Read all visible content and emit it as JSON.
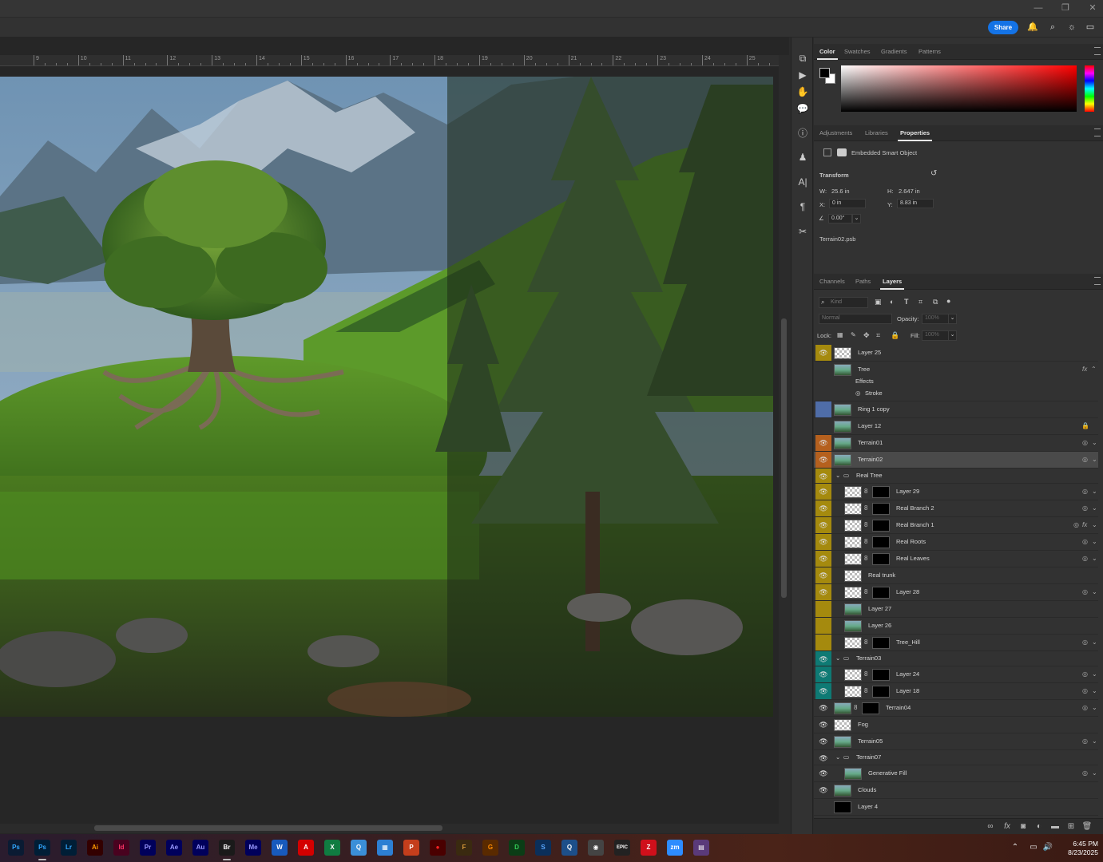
{
  "window": {
    "minimize": "—",
    "restore": "❐",
    "close": "✕"
  },
  "topbar": {
    "share_label": "Share",
    "icons": [
      "bell-icon",
      "search-icon",
      "lightbulb-icon",
      "workspace-icon"
    ]
  },
  "ruler": {
    "labels": [
      "9",
      "10",
      "11",
      "12",
      "13",
      "14",
      "15",
      "16",
      "17",
      "18",
      "19",
      "20",
      "21",
      "22",
      "23",
      "24",
      "25"
    ]
  },
  "color_panel": {
    "tabs": [
      "Color",
      "Swatches",
      "Gradients",
      "Patterns"
    ],
    "active_tab": "Color",
    "foreground": "#000000",
    "background": "#ffffff"
  },
  "properties_panel": {
    "tabs": [
      "Adjustments",
      "Libraries",
      "Properties"
    ],
    "active_tab": "Properties",
    "object_type": "Embedded Smart Object",
    "section_title": "Transform",
    "w_label": "W:",
    "w_value": "25.6 in",
    "h_label": "H:",
    "h_value": "2.647 in",
    "x_label": "X:",
    "x_value": "0 in",
    "y_label": "Y:",
    "y_value": "8.83 in",
    "angle_value": "0.00°",
    "file_name": "Terrain02.psb"
  },
  "layers_panel": {
    "tabs": [
      "Channels",
      "Paths",
      "Layers"
    ],
    "active_tab": "Layers",
    "filter_placeholder": "Kind",
    "blend_mode": "Normal",
    "opacity_label": "Opacity:",
    "opacity_value": "100%",
    "lock_label": "Lock:",
    "fill_label": "Fill:",
    "fill_value": "100%",
    "layers": [
      {
        "name": "Layer 25",
        "color": "#a58a0e",
        "eye": true,
        "thumb": "checker",
        "indent": 0
      },
      {
        "name": "Tree",
        "color": "",
        "eye": false,
        "thumb": "scene",
        "indent": 0,
        "fx": "fx",
        "effects": "Effects",
        "stroke": "Stroke"
      },
      {
        "name": "Ring 1 copy",
        "color": "#4f6da8",
        "eye": false,
        "thumb": "scene",
        "indent": 0
      },
      {
        "name": "Layer 12",
        "color": "",
        "eye": false,
        "thumb": "scene",
        "indent": 0,
        "locked": true
      },
      {
        "name": "Terrain01",
        "color": "#b5601e",
        "eye": true,
        "thumb": "scene",
        "indent": 0
      },
      {
        "name": "Terrain02",
        "color": "#b5601e",
        "eye": true,
        "thumb": "scene",
        "indent": 0,
        "selected": true
      },
      {
        "name": "Real Tree",
        "color": "#a58a0e",
        "eye": true,
        "group": true,
        "indent": 0
      },
      {
        "name": "Layer 29",
        "color": "#a58a0e",
        "eye": true,
        "thumb": "checker",
        "mask": true,
        "indent": 1
      },
      {
        "name": "Real Branch 2",
        "color": "#a58a0e",
        "eye": true,
        "thumb": "checker",
        "mask": true,
        "indent": 1
      },
      {
        "name": "Real Branch 1",
        "color": "#a58a0e",
        "eye": true,
        "thumb": "checker",
        "mask": true,
        "indent": 1,
        "fx": "fx"
      },
      {
        "name": "Real Roots",
        "color": "#a58a0e",
        "eye": true,
        "thumb": "checker",
        "mask": true,
        "indent": 1
      },
      {
        "name": "Real Leaves",
        "color": "#a58a0e",
        "eye": true,
        "thumb": "checker",
        "mask": true,
        "indent": 1
      },
      {
        "name": "Real trunk",
        "color": "#a58a0e",
        "eye": true,
        "thumb": "checker",
        "indent": 1
      },
      {
        "name": "Layer 28",
        "color": "#a58a0e",
        "eye": true,
        "thumb": "checker",
        "mask": true,
        "indent": 1
      },
      {
        "name": "Layer 27",
        "color": "#a58a0e",
        "eye": false,
        "thumb": "scene",
        "indent": 1
      },
      {
        "name": "Layer 26",
        "color": "#a58a0e",
        "eye": false,
        "thumb": "scene",
        "indent": 1
      },
      {
        "name": "Tree_Hill",
        "color": "#a58a0e",
        "eye": false,
        "thumb": "checker",
        "mask": true,
        "indent": 1
      },
      {
        "name": "Terrain03",
        "color": "#0e7a74",
        "eye": true,
        "group": true,
        "indent": 0
      },
      {
        "name": "Layer 24",
        "color": "#0e7a74",
        "eye": true,
        "thumb": "checker",
        "mask": true,
        "indent": 1
      },
      {
        "name": "Layer 18",
        "color": "#0e7a74",
        "eye": true,
        "thumb": "checker",
        "mask": true,
        "indent": 1
      },
      {
        "name": "Terrain04",
        "color": "",
        "eye": true,
        "thumb": "scene",
        "mask": true,
        "indent": 0
      },
      {
        "name": "Fog",
        "color": "",
        "eye": true,
        "thumb": "checker",
        "indent": 0
      },
      {
        "name": "Terrain05",
        "color": "",
        "eye": true,
        "thumb": "scene",
        "indent": 0
      },
      {
        "name": "Terrain07",
        "color": "",
        "eye": true,
        "group": true,
        "indent": 0
      },
      {
        "name": "Generative Fill",
        "color": "",
        "eye": true,
        "thumb": "scene",
        "indent": 1
      },
      {
        "name": "Clouds",
        "color": "",
        "eye": true,
        "thumb": "scene",
        "indent": 0
      },
      {
        "name": "Layer 4",
        "color": "",
        "eye": false,
        "thumb": "black",
        "indent": 0
      }
    ]
  },
  "taskbar": {
    "apps": [
      {
        "label": "Ps",
        "color": "#0a1b33",
        "fg": "#31a8ff"
      },
      {
        "label": "Ps",
        "color": "#001e36",
        "fg": "#31a8ff",
        "active": true
      },
      {
        "label": "Lr",
        "color": "#001e36",
        "fg": "#31a8ff"
      },
      {
        "label": "Ai",
        "color": "#330000",
        "fg": "#ff9a00"
      },
      {
        "label": "Id",
        "color": "#49021f",
        "fg": "#ff3366"
      },
      {
        "label": "Pr",
        "color": "#00005b",
        "fg": "#9999ff"
      },
      {
        "label": "Ae",
        "color": "#00005b",
        "fg": "#9999ff"
      },
      {
        "label": "Au",
        "color": "#00005b",
        "fg": "#9999ff"
      },
      {
        "label": "Br",
        "color": "#1a1a1a",
        "fg": "#ffffff",
        "active": true
      },
      {
        "label": "Me",
        "color": "#00005b",
        "fg": "#9999ff"
      },
      {
        "label": "W",
        "color": "#185abd",
        "fg": "#ffffff"
      },
      {
        "label": "A",
        "color": "#d40000",
        "fg": "#ffffff"
      },
      {
        "label": "X",
        "color": "#107c41",
        "fg": "#ffffff"
      },
      {
        "label": "Q",
        "color": "#3b8fd8",
        "fg": "#ffffff"
      },
      {
        "label": "▦",
        "color": "#2d7fd3",
        "fg": "#ffffff"
      },
      {
        "label": "P",
        "color": "#c43e1c",
        "fg": "#ffffff"
      },
      {
        "label": "●",
        "color": "#4a0000",
        "fg": "#ff2222"
      },
      {
        "label": "F",
        "color": "#3a2a10",
        "fg": "#d89a3a"
      },
      {
        "label": "G",
        "color": "#5a2a00",
        "fg": "#ff8c00"
      },
      {
        "label": "D",
        "color": "#0b3d16",
        "fg": "#34d058"
      },
      {
        "label": "S",
        "color": "#0b2f5a",
        "fg": "#5aa8ff"
      },
      {
        "label": "Q",
        "color": "#1d4f8a",
        "fg": "#ffffff"
      },
      {
        "label": "◉",
        "color": "#444444",
        "fg": "#ffffff"
      },
      {
        "label": "EPIC",
        "color": "#222222",
        "fg": "#ffffff"
      },
      {
        "label": "Z",
        "color": "#d0101b",
        "fg": "#ffffff"
      },
      {
        "label": "zm",
        "color": "#2d8cff",
        "fg": "#ffffff"
      },
      {
        "label": "▤",
        "color": "#5a3a7a",
        "fg": "#ffffff"
      }
    ],
    "time": "6:45 PM",
    "date": "8/23/2025"
  }
}
